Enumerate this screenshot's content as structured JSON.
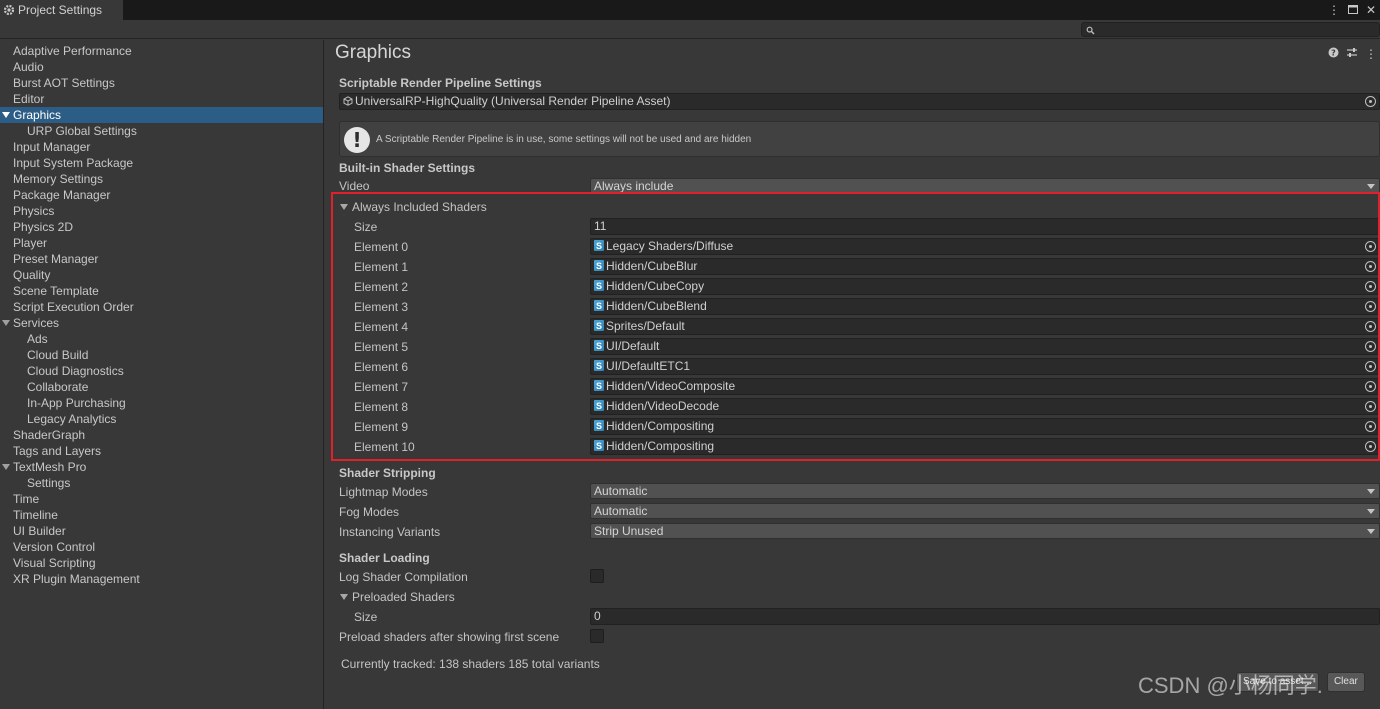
{
  "window": {
    "tab_title": "Project Settings"
  },
  "sidebar": {
    "items": [
      {
        "label": "Adaptive Performance",
        "child": false,
        "selected": false,
        "foldout": false
      },
      {
        "label": "Audio",
        "child": false,
        "selected": false,
        "foldout": false
      },
      {
        "label": "Burst AOT Settings",
        "child": false,
        "selected": false,
        "foldout": false
      },
      {
        "label": "Editor",
        "child": false,
        "selected": false,
        "foldout": false
      },
      {
        "label": "Graphics",
        "child": false,
        "selected": true,
        "foldout": true
      },
      {
        "label": "URP Global Settings",
        "child": true,
        "selected": false,
        "foldout": false
      },
      {
        "label": "Input Manager",
        "child": false,
        "selected": false,
        "foldout": false
      },
      {
        "label": "Input System Package",
        "child": false,
        "selected": false,
        "foldout": false
      },
      {
        "label": "Memory Settings",
        "child": false,
        "selected": false,
        "foldout": false
      },
      {
        "label": "Package Manager",
        "child": false,
        "selected": false,
        "foldout": false
      },
      {
        "label": "Physics",
        "child": false,
        "selected": false,
        "foldout": false
      },
      {
        "label": "Physics 2D",
        "child": false,
        "selected": false,
        "foldout": false
      },
      {
        "label": "Player",
        "child": false,
        "selected": false,
        "foldout": false
      },
      {
        "label": "Preset Manager",
        "child": false,
        "selected": false,
        "foldout": false
      },
      {
        "label": "Quality",
        "child": false,
        "selected": false,
        "foldout": false
      },
      {
        "label": "Scene Template",
        "child": false,
        "selected": false,
        "foldout": false
      },
      {
        "label": "Script Execution Order",
        "child": false,
        "selected": false,
        "foldout": false
      },
      {
        "label": "Services",
        "child": false,
        "selected": false,
        "foldout": true
      },
      {
        "label": "Ads",
        "child": true,
        "selected": false,
        "foldout": false
      },
      {
        "label": "Cloud Build",
        "child": true,
        "selected": false,
        "foldout": false
      },
      {
        "label": "Cloud Diagnostics",
        "child": true,
        "selected": false,
        "foldout": false
      },
      {
        "label": "Collaborate",
        "child": true,
        "selected": false,
        "foldout": false
      },
      {
        "label": "In-App Purchasing",
        "child": true,
        "selected": false,
        "foldout": false
      },
      {
        "label": "Legacy Analytics",
        "child": true,
        "selected": false,
        "foldout": false
      },
      {
        "label": "ShaderGraph",
        "child": false,
        "selected": false,
        "foldout": false
      },
      {
        "label": "Tags and Layers",
        "child": false,
        "selected": false,
        "foldout": false
      },
      {
        "label": "TextMesh Pro",
        "child": false,
        "selected": false,
        "foldout": true
      },
      {
        "label": "Settings",
        "child": true,
        "selected": false,
        "foldout": false
      },
      {
        "label": "Time",
        "child": false,
        "selected": false,
        "foldout": false
      },
      {
        "label": "Timeline",
        "child": false,
        "selected": false,
        "foldout": false
      },
      {
        "label": "UI Builder",
        "child": false,
        "selected": false,
        "foldout": false
      },
      {
        "label": "Version Control",
        "child": false,
        "selected": false,
        "foldout": false
      },
      {
        "label": "Visual Scripting",
        "child": false,
        "selected": false,
        "foldout": false
      },
      {
        "label": "XR Plugin Management",
        "child": false,
        "selected": false,
        "foldout": false
      }
    ]
  },
  "main": {
    "title": "Graphics",
    "srp_section": "Scriptable Render Pipeline Settings",
    "srp_asset": "UniversalRP-HighQuality (Universal Render Pipeline Asset)",
    "help_message": "A Scriptable Render Pipeline is in use, some settings will not be used and are hidden",
    "builtin_section": "Built-in Shader Settings",
    "video_label": "Video",
    "video_value": "Always include",
    "always_included_label": "Always Included Shaders",
    "size_label": "Size",
    "size_value": "11",
    "elements": [
      {
        "label": "Element 0",
        "value": "Legacy Shaders/Diffuse"
      },
      {
        "label": "Element 1",
        "value": "Hidden/CubeBlur"
      },
      {
        "label": "Element 2",
        "value": "Hidden/CubeCopy"
      },
      {
        "label": "Element 3",
        "value": "Hidden/CubeBlend"
      },
      {
        "label": "Element 4",
        "value": "Sprites/Default"
      },
      {
        "label": "Element 5",
        "value": "UI/Default"
      },
      {
        "label": "Element 6",
        "value": "UI/DefaultETC1"
      },
      {
        "label": "Element 7",
        "value": "Hidden/VideoComposite"
      },
      {
        "label": "Element 8",
        "value": "Hidden/VideoDecode"
      },
      {
        "label": "Element 9",
        "value": "Hidden/Compositing"
      },
      {
        "label": "Element 10",
        "value": "Hidden/Compositing"
      }
    ],
    "stripping_section": "Shader Stripping",
    "lightmap_label": "Lightmap Modes",
    "lightmap_value": "Automatic",
    "fog_label": "Fog Modes",
    "fog_value": "Automatic",
    "instancing_label": "Instancing Variants",
    "instancing_value": "Strip Unused",
    "loading_section": "Shader Loading",
    "log_compilation_label": "Log Shader Compilation",
    "preloaded_label": "Preloaded Shaders",
    "preloaded_size_label": "Size",
    "preloaded_size_value": "0",
    "preload_after_label": "Preload shaders after showing first scene",
    "tracked_text": "Currently tracked: 138 shaders 185 total variants",
    "save_button": "Save to asset...",
    "clear_button": "Clear"
  },
  "watermark": "CSDN @小杨同学.",
  "colors": {
    "selection": "#2c5d87",
    "highlight_border": "#e0202b",
    "background": "#383838"
  }
}
